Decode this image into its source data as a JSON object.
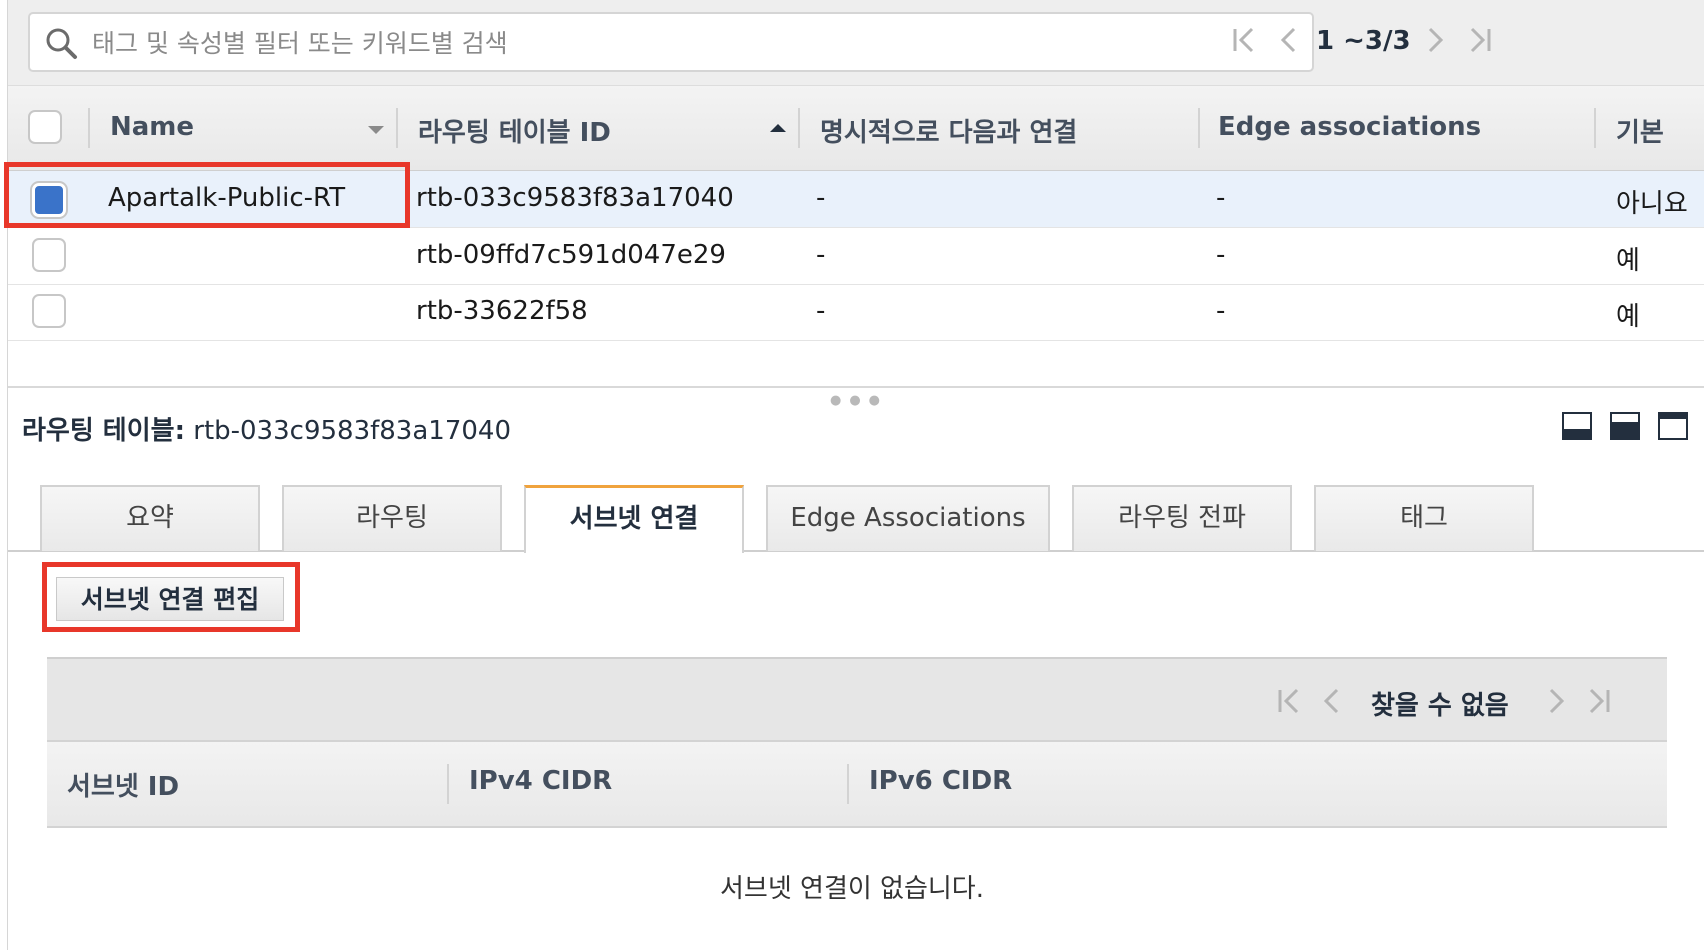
{
  "search": {
    "placeholder": "태그 및 속성별 필터 또는 키워드별 검색",
    "value": ""
  },
  "pager": {
    "range": "1 ~3/3"
  },
  "table": {
    "columns": [
      "Name",
      "라우팅 테이블 ID",
      "명시적으로 다음과 연결",
      "Edge associations",
      "기본"
    ],
    "rows": [
      {
        "name": "Apartalk-Public-RT",
        "id": "rtb-033c9583f83a17040",
        "explicit": "-",
        "edge": "-",
        "main": "아니요",
        "selected": true
      },
      {
        "name": "",
        "id": "rtb-09ffd7c591d047e29",
        "explicit": "-",
        "edge": "-",
        "main": "예",
        "selected": false
      },
      {
        "name": "",
        "id": "rtb-33622f58",
        "explicit": "-",
        "edge": "-",
        "main": "예",
        "selected": false
      }
    ]
  },
  "detail": {
    "label": "라우팅 테이블:",
    "value": "rtb-033c9583f83a17040"
  },
  "tabs": [
    {
      "label": "요약",
      "active": false
    },
    {
      "label": "라우팅",
      "active": false
    },
    {
      "label": "서브넷 연결",
      "active": true
    },
    {
      "label": "Edge Associations",
      "active": false
    },
    {
      "label": "라우팅 전파",
      "active": false
    },
    {
      "label": "태그",
      "active": false
    }
  ],
  "subnet": {
    "edit_button": "서브넷 연결 편집",
    "pager_text": "찾을 수 없음",
    "columns": [
      "서브넷 ID",
      "IPv4 CIDR",
      "IPv6 CIDR"
    ],
    "empty_message": "서브넷 연결이 없습니다."
  },
  "colors": {
    "highlight": "#e8372a",
    "selected_row": "#e9f1fb",
    "checkbox_checked": "#3a73c9",
    "tab_active_accent": "#f0a33d"
  }
}
